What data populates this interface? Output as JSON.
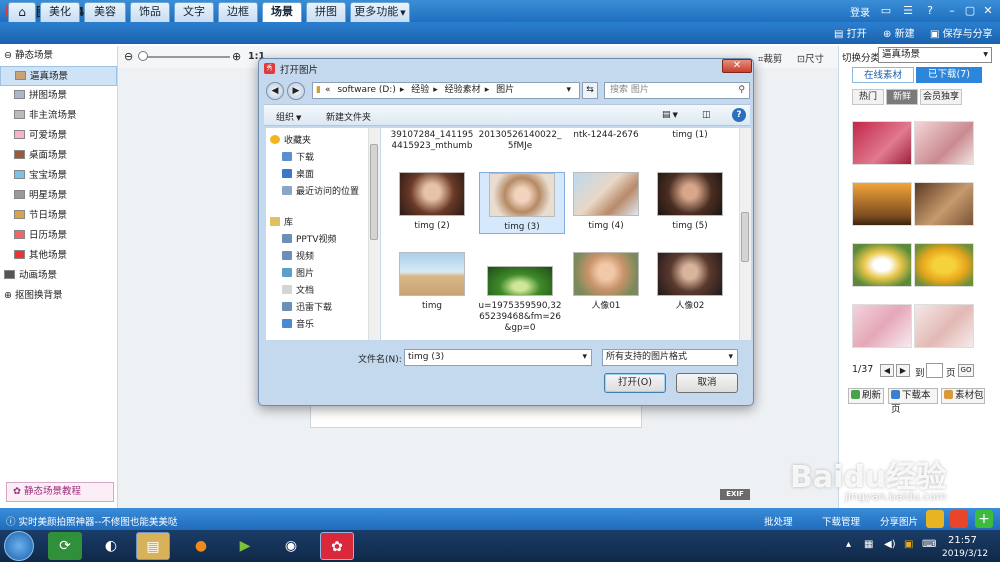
{
  "window": {
    "title": "美图秀秀 4.0.1",
    "logo_text": "秀",
    "login": "登录"
  },
  "nav": {
    "tabs": [
      "美化",
      "美容",
      "饰品",
      "文字",
      "边框",
      "场景",
      "拼图",
      "更多功能"
    ],
    "active": "场景",
    "open": "打开",
    "new": "新建",
    "save_share": "保存与分享"
  },
  "left_panel": {
    "static_scenes": "静态场景",
    "items": [
      "逼真场景",
      "拼图场景",
      "非主流场景",
      "可爱场景",
      "桌面场景",
      "宝宝场景",
      "明星场景",
      "节日场景",
      "日历场景",
      "其他场景"
    ],
    "selected": "逼真场景",
    "animated": "动画场景",
    "matting": "抠图换背景",
    "tutorial": "静态场景教程"
  },
  "editor_tools": {
    "ratio": "1:1",
    "crop": "裁剪",
    "size": "尺寸",
    "exif": "EXIF"
  },
  "right_panel": {
    "category_label": "切换分类",
    "category_value": "逼真场景",
    "tab_online": "在线素材",
    "tab_downloaded": "已下载",
    "downloaded_count": "(7)",
    "subtabs": [
      "热门",
      "新鲜",
      "会员独享"
    ],
    "active_subtab": "新鲜",
    "pager": {
      "page": "1/37",
      "to_label": "到",
      "page_label": "页",
      "go": "GO"
    },
    "refresh": "刷新",
    "download_page": "下载本页",
    "library": "素材包"
  },
  "status_bar": {
    "text": "实时美颜拍照神器--不修图也能美美哒",
    "batch": "批处理",
    "download_manager": "下载管理",
    "share_image": "分享图片"
  },
  "taskbar": {
    "time": "21:57",
    "date": "2019/3/12"
  },
  "dialog": {
    "title": "打开图片",
    "path": [
      "software (D:)",
      "经验",
      "经验素材",
      "图片"
    ],
    "search_placeholder": "搜索 图片",
    "organize": "组织",
    "new_folder": "新建文件夹",
    "nav": {
      "favorites": "收藏夹",
      "fav_items": [
        "下载",
        "桌面",
        "最近访问的位置"
      ],
      "library": "库",
      "lib_items": [
        "PPTV视频",
        "视频",
        "图片",
        "文档",
        "迅雷下载",
        "音乐"
      ]
    },
    "files": [
      {
        "name": "39107284_1411954415923_mthumb"
      },
      {
        "name": "20130526140022_5fMJe"
      },
      {
        "name": "ntk-1244-2676"
      },
      {
        "name": "timg (1)"
      },
      {
        "name": "timg (2)"
      },
      {
        "name": "timg (3)"
      },
      {
        "name": "timg (4)"
      },
      {
        "name": "timg (5)"
      },
      {
        "name": "timg"
      },
      {
        "name": "u=1975359590,3265239468&fm=26&gp=0"
      },
      {
        "name": "人像01"
      },
      {
        "name": "人像02"
      }
    ],
    "selected_file": "timg (3)",
    "filename_label": "文件名(N):",
    "filename_value": "timg (3)",
    "filetype_value": "所有支持的图片格式",
    "open_button": "打开(O)",
    "cancel_button": "取消"
  },
  "watermark": {
    "main": "Baidu经验",
    "sub": "jingyan.baidu.com"
  },
  "colors": {
    "app_blue": "#1f6fbf",
    "selection": "#d6e8fb",
    "download_tab": "#2c86dc"
  }
}
